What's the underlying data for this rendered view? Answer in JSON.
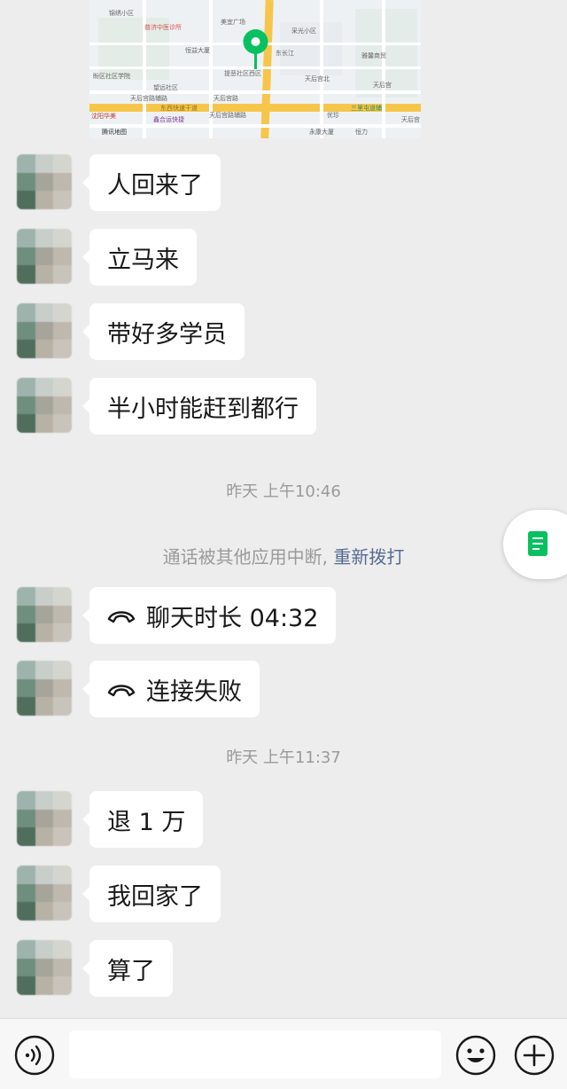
{
  "map": {
    "labels": {
      "l1": "锦绣小区",
      "l2": "普济中医诊所",
      "l3": "美宜广场",
      "l4": "采光小区",
      "l5": "恒益大厦",
      "l6": "东长江",
      "l7": "提恶社区西区",
      "l8": "天后宫北",
      "l9": "雅馨商贸",
      "l10": "天后宫",
      "l11": "盼区社区学院",
      "l12": "望远社区",
      "l13": "天后宫路辅路",
      "l14": "东西快速干道",
      "l15": "天后宫路",
      "l16": "三里屯道辅",
      "l17": "沈阳华美",
      "l18": "鑫合运快捷",
      "l19": "天后宫路辅路",
      "l20": "优珍",
      "l21": "天后宫",
      "l22": "腾讯地图",
      "l23": "永康大厦",
      "l24": "恒力"
    }
  },
  "messages": [
    {
      "text": "人回来了"
    },
    {
      "text": "立马来"
    },
    {
      "text": "带好多学员"
    },
    {
      "text": "半小时能赶到都行"
    },
    {
      "text": "聊天时长 04:32"
    },
    {
      "text": "连接失败"
    },
    {
      "text": "退 1 万"
    },
    {
      "text": "我回家了"
    },
    {
      "text": "算了"
    }
  ],
  "timestamps": [
    "昨天 上午10:46",
    "昨天 上午11:37"
  ],
  "system": {
    "notice": "通话被其他应用中断, ",
    "redial": "重新拨打"
  },
  "input": {
    "value": ""
  },
  "colors": {
    "accent_green": "#07c160",
    "link_blue": "#576b95",
    "bubble_white": "#ffffff",
    "background": "#ededed"
  },
  "icons": [
    "voice-icon",
    "emoji-icon",
    "plus-icon",
    "phone-hangup-icon",
    "document-icon",
    "map-pin-icon"
  ]
}
